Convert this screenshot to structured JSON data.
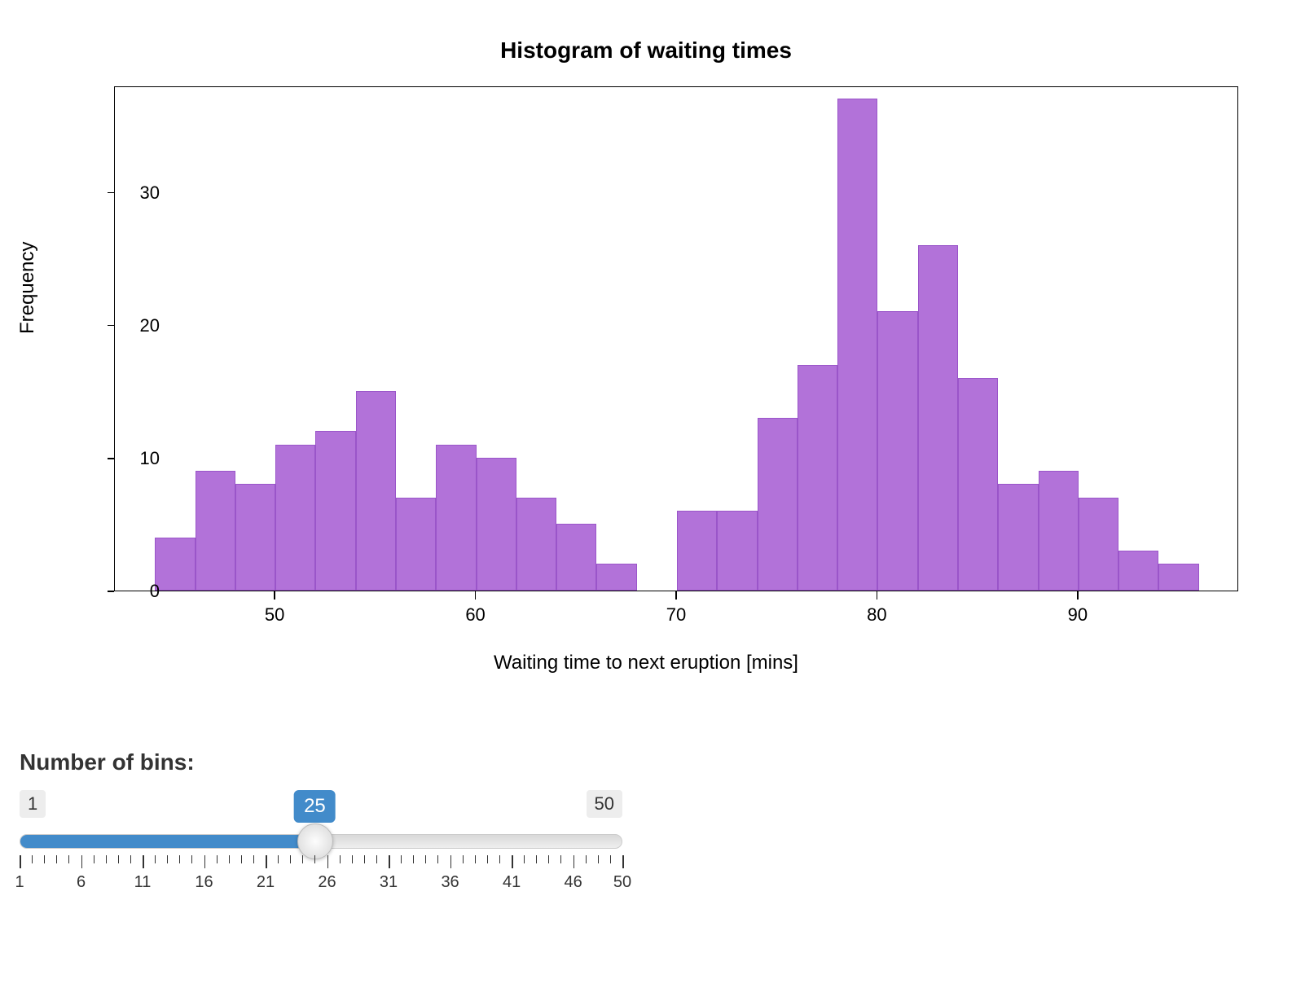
{
  "chart_data": {
    "type": "bar",
    "title": "Histogram of waiting times",
    "xlabel": "Waiting time to next eruption [mins]",
    "ylabel": "Frequency",
    "xlim": [
      42,
      98
    ],
    "ylim": [
      0,
      38
    ],
    "xticks": [
      50,
      60,
      70,
      80,
      90
    ],
    "yticks": [
      0,
      10,
      20,
      30
    ],
    "bin_width": 2,
    "bin_edges": [
      44,
      46,
      48,
      50,
      52,
      54,
      56,
      58,
      60,
      62,
      64,
      66,
      68,
      70,
      72,
      74,
      76,
      78,
      80,
      82,
      84,
      86,
      88,
      90,
      92,
      94,
      96
    ],
    "values": [
      4,
      9,
      8,
      11,
      12,
      15,
      7,
      11,
      10,
      7,
      5,
      2,
      0,
      6,
      6,
      13,
      17,
      37,
      21,
      26,
      16,
      8,
      9,
      7,
      3,
      2
    ],
    "bar_color": "#b272d9"
  },
  "slider": {
    "label": "Number of bins:",
    "min": 1,
    "max": 50,
    "value": 25,
    "major_ticks": [
      1,
      6,
      11,
      16,
      21,
      26,
      31,
      36,
      41,
      46,
      50
    ]
  }
}
